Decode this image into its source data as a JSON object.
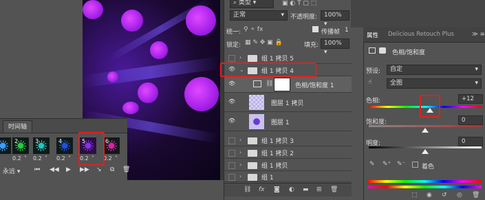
{
  "layers_panel": {
    "type_filter": "类型",
    "blend_mode": "正常",
    "opacity_label": "不透明度:",
    "opacity_value": "100%",
    "unify_label": "统一:",
    "propagate_label": "传播帧",
    "propagate_value": "1",
    "lock_label": "锁定:",
    "fill_label": "填充:",
    "fill_value": "100%",
    "layers": [
      {
        "name": "组 1 拷贝 5",
        "type": "group",
        "visible": false
      },
      {
        "name": "组 1 拷贝 4",
        "type": "group",
        "visible": true,
        "expanded": true
      },
      {
        "name": "色相/饱和度 1",
        "type": "adjustment",
        "visible": true
      },
      {
        "name": "图层 1 拷贝",
        "type": "layer",
        "visible": true
      },
      {
        "name": "图层 1",
        "type": "layer",
        "visible": true
      },
      {
        "name": "组 1 拷贝 3",
        "type": "group",
        "visible": false
      },
      {
        "name": "组 1 拷贝 2",
        "type": "group",
        "visible": false
      },
      {
        "name": "组 1 拷贝",
        "type": "group",
        "visible": false
      },
      {
        "name": "组 1",
        "type": "group",
        "visible": false
      }
    ],
    "footer_icons": [
      "link-icon",
      "fx-icon",
      "mask-icon",
      "adjustment-icon",
      "folder-icon",
      "new-layer-icon",
      "trash-icon"
    ]
  },
  "properties": {
    "tab_active": "属性",
    "tab_other": "Delicious Retouch Plus",
    "title": "色相/饱和度",
    "preset_label": "预设:",
    "preset_value": "自定",
    "channel_value": "全图",
    "hue_label": "色相:",
    "hue_value": "+12",
    "hue_position": 0.54,
    "saturation_label": "饱和度:",
    "saturation_value": "0",
    "saturation_position": 0.5,
    "lightness_label": "明度:",
    "lightness_value": "0",
    "lightness_position": 0.5,
    "colorize_label": "着色"
  },
  "timeline": {
    "tab_label": "时间轴",
    "loop_value": "永远",
    "frames": [
      {
        "num": "",
        "delay": "",
        "color": "#3aa0ff"
      },
      {
        "num": "2",
        "delay": "0.2",
        "color": "#20d040"
      },
      {
        "num": "3",
        "delay": "0.2",
        "color": "#20c8c0"
      },
      {
        "num": "4",
        "delay": "0.2",
        "color": "#2050e0"
      },
      {
        "num": "5",
        "delay": "0.2",
        "color": "#8830f0"
      },
      {
        "num": "6",
        "delay": "0.2",
        "color": "#e020b0"
      }
    ]
  }
}
